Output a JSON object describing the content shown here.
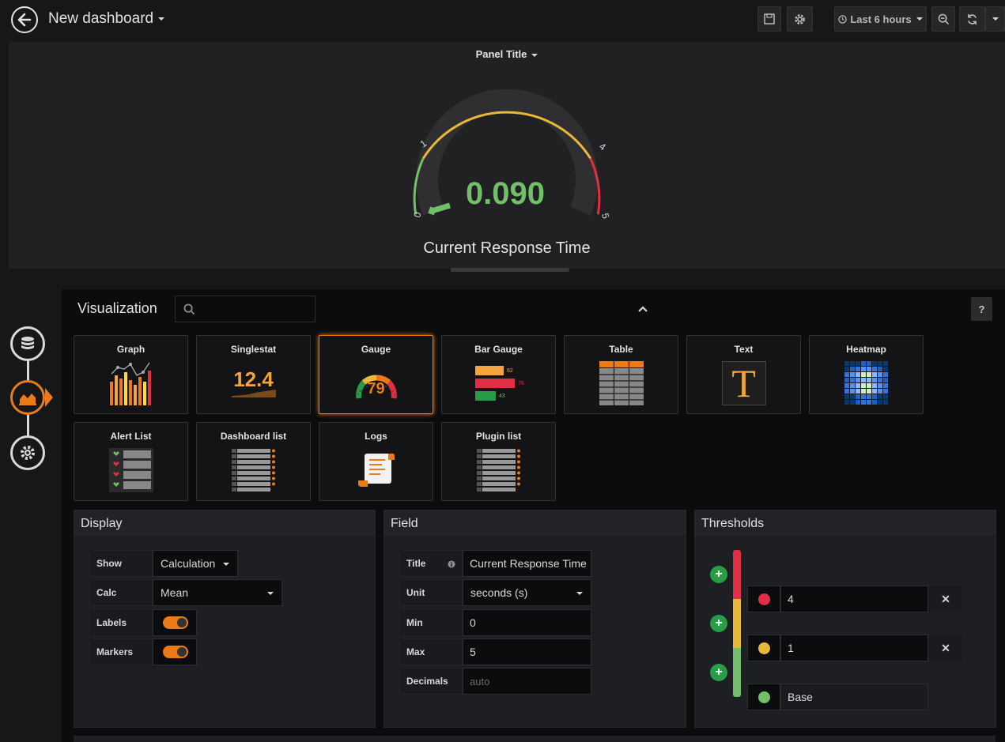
{
  "header": {
    "title": "New dashboard",
    "time_range": "Last 6 hours"
  },
  "panel": {
    "title": "Panel Title",
    "gauge": {
      "value": "0.090",
      "label": "Current Response Time",
      "min": 0,
      "max": 5,
      "tick_labels": [
        "0",
        "1",
        "4",
        "5"
      ],
      "colors": {
        "green": "#73bf69",
        "yellow": "#fade2a",
        "red": "#f2495c"
      }
    }
  },
  "visualization": {
    "title": "Visualization",
    "help": "?",
    "types": [
      {
        "label": "Graph"
      },
      {
        "label": "Singlestat",
        "sample": "12.4"
      },
      {
        "label": "Gauge",
        "sample": "79",
        "selected": true
      },
      {
        "label": "Bar Gauge",
        "samples": [
          "62",
          "76",
          "43"
        ]
      },
      {
        "label": "Table"
      },
      {
        "label": "Text",
        "sample": "T"
      },
      {
        "label": "Heatmap"
      },
      {
        "label": "Alert List"
      },
      {
        "label": "Dashboard list"
      },
      {
        "label": "Logs"
      },
      {
        "label": "Plugin list"
      }
    ]
  },
  "display": {
    "title": "Display",
    "show_label": "Show",
    "show_value": "Calculation",
    "calc_label": "Calc",
    "calc_value": "Mean",
    "labels_label": "Labels",
    "labels_on": true,
    "markers_label": "Markers",
    "markers_on": true
  },
  "field": {
    "title": "Field",
    "title_label": "Title",
    "title_value": "Current Response Time",
    "unit_label": "Unit",
    "unit_value": "seconds (s)",
    "min_label": "Min",
    "min_value": "0",
    "max_label": "Max",
    "max_value": "5",
    "decimals_label": "Decimals",
    "decimals_placeholder": "auto"
  },
  "thresholds": {
    "title": "Thresholds",
    "items": [
      {
        "value": "4",
        "color": "#e02f44"
      },
      {
        "value": "1",
        "color": "#eab839"
      },
      {
        "value": "Base",
        "color": "#73bf69"
      }
    ]
  }
}
